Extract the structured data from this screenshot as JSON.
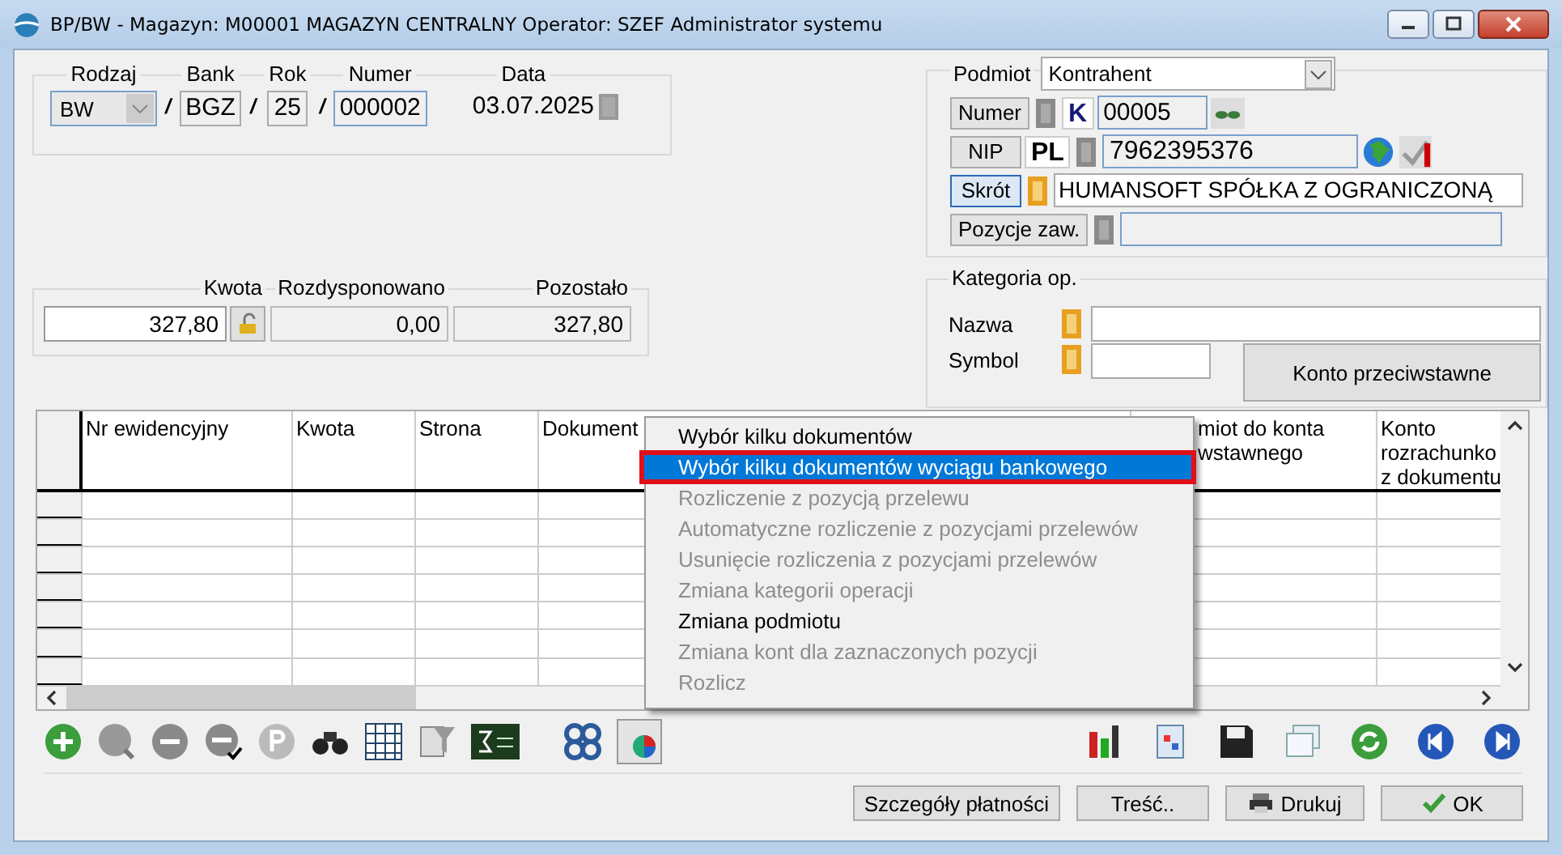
{
  "window": {
    "title": "BP/BW - Magazyn: M00001 MAGAZYN CENTRALNY  Operator: SZEF Administrator systemu"
  },
  "document": {
    "fields": [
      {
        "label": "Rodzaj",
        "value": "BW",
        "kind": "combo"
      },
      {
        "label": "Bank",
        "value": "BGZ",
        "kind": "text",
        "prefix": "/"
      },
      {
        "label": "Rok",
        "value": "25",
        "kind": "text",
        "prefix": "/"
      },
      {
        "label": "Numer",
        "value": "000002",
        "kind": "text",
        "prefix": "/"
      },
      {
        "label": "Data",
        "value": "03.07.2025",
        "kind": "date"
      }
    ]
  },
  "amounts": [
    {
      "label": "Kwota",
      "value": "327,80",
      "editable": true
    },
    {
      "label": "Rozdysponowano",
      "value": "0,00",
      "editable": false
    },
    {
      "label": "Pozostało",
      "value": "327,80",
      "editable": false
    }
  ],
  "podmiot": {
    "label": "Podmiot",
    "type": "Kontrahent",
    "numer_button": "Numer",
    "prefix": "K",
    "numer": "00005",
    "nip_button": "NIP",
    "country": "PL",
    "nip": "7962395376",
    "skrot_button": "Skrót",
    "skrot": "HUMANSOFT SPÓŁKA Z OGRANICZONĄ",
    "positions_button": "Pozycje zaw."
  },
  "kategoria": {
    "title": "Kategoria op.",
    "name_label": "Nazwa",
    "symbol_label": "Symbol",
    "button": "Konto przeciwstawne"
  },
  "table": {
    "columns": [
      {
        "lines": [
          "Nr ewidencyjny"
        ]
      },
      {
        "lines": [
          "Kwota"
        ]
      },
      {
        "lines": [
          "Strona"
        ]
      },
      {
        "lines": [
          "Dokument"
        ]
      },
      {
        "lines": [
          "miot do konta",
          "wstawnego"
        ]
      },
      {
        "lines": [
          "Konto",
          "rozrachunko",
          "z dokumentu"
        ]
      }
    ]
  },
  "context_menu": [
    {
      "label": "Wybór kilku dokumentów",
      "disabled": false,
      "selected": false
    },
    {
      "label": "Wybór kilku dokumentów wyciągu bankowego",
      "disabled": false,
      "selected": true
    },
    {
      "label": "Rozliczenie z pozycją przelewu",
      "disabled": true,
      "selected": false
    },
    {
      "label": "Automatyczne rozliczenie z pozycjami przelewów",
      "disabled": true,
      "selected": false
    },
    {
      "label": "Usunięcie rozliczenia z pozycjami przelewów",
      "disabled": true,
      "selected": false
    },
    {
      "label": "Zmiana kategorii operacji",
      "disabled": true,
      "selected": false
    },
    {
      "label": "Zmiana podmiotu",
      "disabled": false,
      "selected": false
    },
    {
      "label": "Zmiana kont dla zaznaczonych pozycji",
      "disabled": true,
      "selected": false
    },
    {
      "label": "Rozlicz",
      "disabled": true,
      "selected": false
    }
  ],
  "buttons": [
    {
      "label": "Szczegóły płatności",
      "kind": "plain"
    },
    {
      "label": "Treść..",
      "kind": "plain"
    },
    {
      "label": "Drukuj",
      "kind": "print"
    },
    {
      "label": "OK",
      "kind": "ok"
    }
  ]
}
